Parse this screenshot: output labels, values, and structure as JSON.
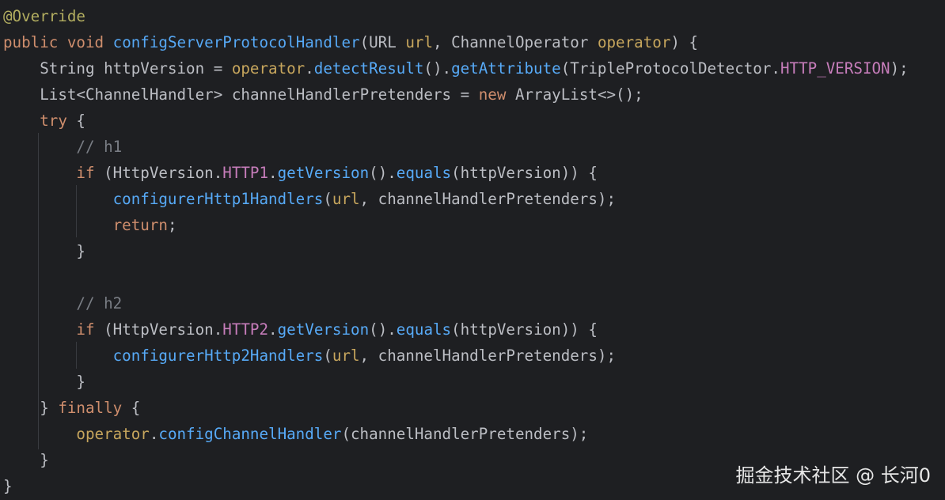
{
  "editor": {
    "background": "#1e1f22",
    "lines": [
      [
        {
          "text": "@Override",
          "kind": "ann"
        }
      ],
      [
        {
          "text": "public",
          "kind": "kw"
        },
        {
          "text": " ",
          "kind": "plain"
        },
        {
          "text": "void",
          "kind": "kw"
        },
        {
          "text": " ",
          "kind": "plain"
        },
        {
          "text": "configServerProtocolHandler",
          "kind": "fn"
        },
        {
          "text": "(",
          "kind": "plain"
        },
        {
          "text": "URL",
          "kind": "plain"
        },
        {
          "text": " ",
          "kind": "plain"
        },
        {
          "text": "url",
          "kind": "orange"
        },
        {
          "text": ", ",
          "kind": "plain"
        },
        {
          "text": "ChannelOperator",
          "kind": "plain"
        },
        {
          "text": " ",
          "kind": "plain"
        },
        {
          "text": "operator",
          "kind": "orange"
        },
        {
          "text": ") {",
          "kind": "plain"
        }
      ],
      [
        {
          "text": "    ",
          "kind": "plain"
        },
        {
          "text": "String",
          "kind": "plain"
        },
        {
          "text": " httpVersion = ",
          "kind": "plain"
        },
        {
          "text": "operator",
          "kind": "orange"
        },
        {
          "text": ".",
          "kind": "plain"
        },
        {
          "text": "detectResult",
          "kind": "methodcall"
        },
        {
          "text": "().",
          "kind": "plain"
        },
        {
          "text": "getAttribute",
          "kind": "methodcall"
        },
        {
          "text": "(",
          "kind": "plain"
        },
        {
          "text": "TripleProtocolDetector",
          "kind": "plain"
        },
        {
          "text": ".",
          "kind": "plain"
        },
        {
          "text": "HTTP_VERSION",
          "kind": "field"
        },
        {
          "text": ");",
          "kind": "plain"
        }
      ],
      [
        {
          "text": "    ",
          "kind": "plain"
        },
        {
          "text": "List",
          "kind": "plain"
        },
        {
          "text": "<",
          "kind": "plain"
        },
        {
          "text": "ChannelHandler",
          "kind": "plain"
        },
        {
          "text": "> channelHandlerPretenders = ",
          "kind": "plain"
        },
        {
          "text": "new",
          "kind": "kw"
        },
        {
          "text": " ",
          "kind": "plain"
        },
        {
          "text": "ArrayList",
          "kind": "plain"
        },
        {
          "text": "<>();",
          "kind": "plain"
        }
      ],
      [
        {
          "text": "    ",
          "kind": "plain"
        },
        {
          "text": "try",
          "kind": "kw"
        },
        {
          "text": " {",
          "kind": "plain"
        }
      ],
      [
        {
          "text": "        ",
          "kind": "plain"
        },
        {
          "text": "// h1",
          "kind": "comment"
        }
      ],
      [
        {
          "text": "        ",
          "kind": "plain"
        },
        {
          "text": "if",
          "kind": "kw"
        },
        {
          "text": " (",
          "kind": "plain"
        },
        {
          "text": "HttpVersion",
          "kind": "plain"
        },
        {
          "text": ".",
          "kind": "plain"
        },
        {
          "text": "HTTP1",
          "kind": "field"
        },
        {
          "text": ".",
          "kind": "plain"
        },
        {
          "text": "getVersion",
          "kind": "methodcall"
        },
        {
          "text": "().",
          "kind": "plain"
        },
        {
          "text": "equals",
          "kind": "methodcall"
        },
        {
          "text": "(httpVersion)) {",
          "kind": "plain"
        }
      ],
      [
        {
          "text": "            ",
          "kind": "plain"
        },
        {
          "text": "configurerHttp1Handlers",
          "kind": "methodcall"
        },
        {
          "text": "(",
          "kind": "plain"
        },
        {
          "text": "url",
          "kind": "orange"
        },
        {
          "text": ", channelHandlerPretenders);",
          "kind": "plain"
        }
      ],
      [
        {
          "text": "            ",
          "kind": "plain"
        },
        {
          "text": "return",
          "kind": "kw"
        },
        {
          "text": ";",
          "kind": "plain"
        }
      ],
      [
        {
          "text": "        }",
          "kind": "plain"
        }
      ],
      [
        {
          "text": "",
          "kind": "plain"
        }
      ],
      [
        {
          "text": "        ",
          "kind": "plain"
        },
        {
          "text": "// h2",
          "kind": "comment"
        }
      ],
      [
        {
          "text": "        ",
          "kind": "plain"
        },
        {
          "text": "if",
          "kind": "kw"
        },
        {
          "text": " (",
          "kind": "plain"
        },
        {
          "text": "HttpVersion",
          "kind": "plain"
        },
        {
          "text": ".",
          "kind": "plain"
        },
        {
          "text": "HTTP2",
          "kind": "field"
        },
        {
          "text": ".",
          "kind": "plain"
        },
        {
          "text": "getVersion",
          "kind": "methodcall"
        },
        {
          "text": "().",
          "kind": "plain"
        },
        {
          "text": "equals",
          "kind": "methodcall"
        },
        {
          "text": "(httpVersion)) {",
          "kind": "plain"
        }
      ],
      [
        {
          "text": "            ",
          "kind": "plain"
        },
        {
          "text": "configurerHttp2Handlers",
          "kind": "methodcall"
        },
        {
          "text": "(",
          "kind": "plain"
        },
        {
          "text": "url",
          "kind": "orange"
        },
        {
          "text": ", channelHandlerPretenders);",
          "kind": "plain"
        }
      ],
      [
        {
          "text": "        }",
          "kind": "plain"
        }
      ],
      [
        {
          "text": "    } ",
          "kind": "plain"
        },
        {
          "text": "finally",
          "kind": "kw"
        },
        {
          "text": " {",
          "kind": "plain"
        }
      ],
      [
        {
          "text": "        ",
          "kind": "plain"
        },
        {
          "text": "operator",
          "kind": "orange"
        },
        {
          "text": ".",
          "kind": "plain"
        },
        {
          "text": "configChannelHandler",
          "kind": "methodcall"
        },
        {
          "text": "(channelHandlerPretenders);",
          "kind": "plain"
        }
      ],
      [
        {
          "text": "    }",
          "kind": "plain"
        }
      ],
      [
        {
          "text": "}",
          "kind": "plain"
        }
      ]
    ]
  },
  "watermark": {
    "text": "掘金技术社区 @ 长河0"
  }
}
